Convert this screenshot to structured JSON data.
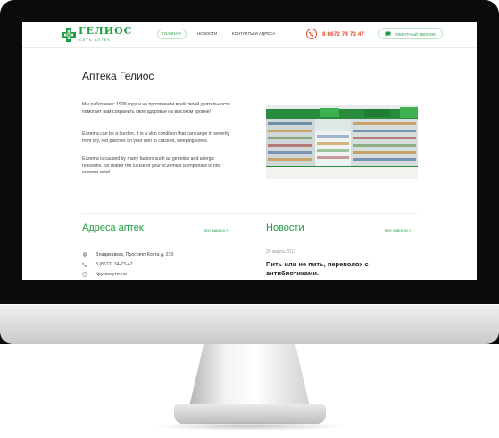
{
  "header": {
    "logo_title": "ГЕЛИОС",
    "logo_subtitle": "СЕТЬ АПТЕК",
    "nav": [
      "ГЛАВНАЯ",
      "НОВОСТИ",
      "КОНТАКТЫ И АДРЕСА"
    ],
    "active_nav": 0,
    "phone": "8 8672 74 73 47",
    "callback_label": "ОБРАТНЫЙ ЗВОНОК"
  },
  "about": {
    "title": "Аптека Гелиос",
    "paragraphs": [
      "Мы работаем с 1999 года и на протяжении всей своей деятельности помогает вам сохранить свое здоровье на высоком уровне!",
      "Eczema can be a burden. It is a skin condition that can range in severity from dry, red patches on your skin to cracked, weeping sores.",
      "Eczema is caused by many factors such as genetics and allergic reactions. No matter the cause of your eczema it is important to find eczema relief."
    ]
  },
  "addresses": {
    "title": "Адреса аптек",
    "all_link": "Все адреса >",
    "address": "Владикавказ, Проспект Коста д. 270",
    "phone": "8 (8672) 74-73-47",
    "hours": "Круглосуточно"
  },
  "news": {
    "title": "Новости",
    "all_link": "Все новости >",
    "date": "29 марта 2017",
    "headline": "Пить или не пить, переполох с антибиотиками."
  },
  "colors": {
    "brand_green": "#1e9e43",
    "phone_red": "#e94b2e"
  }
}
